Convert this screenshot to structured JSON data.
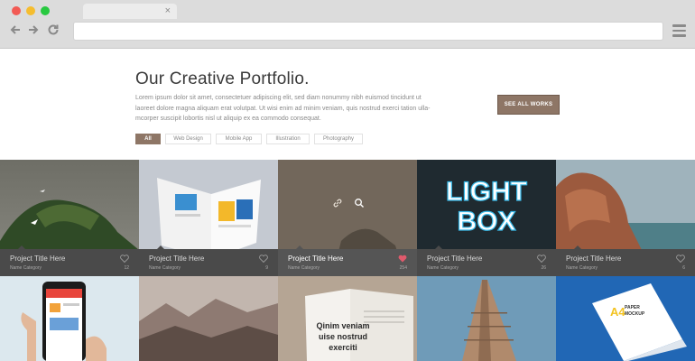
{
  "page": {
    "title": "Our Creative Portfolio.",
    "intro_lines": [
      "Lorem ipsum dolor sit amet, consectetuer adipiscing elit, sed diam nonummy nibh euismod tincidunt ut",
      "laoreet dolore magna aliquam erat volutpat. Ut wisi enim ad minim veniam, quis nostrud exerci tation ulla-",
      "mcorper suscipit lobortis nisl ut aliquip ex ea commodo consequat."
    ],
    "see_all_label": "SEE ALL WORKS",
    "filters": [
      "All",
      "Web Design",
      "Mobile App",
      "Illustration",
      "Photography"
    ],
    "active_filter": "All"
  },
  "projects": [
    {
      "title": "Project Title Here",
      "category": "Name Category",
      "likes": "12",
      "liked": false
    },
    {
      "title": "Project Title Here",
      "category": "Name Category",
      "likes": "9",
      "liked": false
    },
    {
      "title": "Project Title Here",
      "category": "Name Category",
      "likes": "254",
      "liked": true
    },
    {
      "title": "Project Title Here",
      "category": "Name Category",
      "likes": "26",
      "liked": false
    },
    {
      "title": "Project Title Here",
      "category": "Name Category",
      "likes": "6",
      "liked": false
    }
  ],
  "image_text": {
    "lightbox_line1": "LIGHT",
    "lightbox_line2": "BOX",
    "book_text": [
      "Qinim veniam",
      "uise nostrud",
      "exerciti"
    ],
    "paper_mockup": [
      "A4",
      "PAPER",
      "MOCKUP"
    ]
  },
  "colors": {
    "accent": "#8e7666",
    "caption_bg": "#4a4a4a",
    "heart_active": "#e05a6c"
  },
  "icons": {
    "link": "link-icon",
    "search": "search-icon",
    "heart": "heart-icon"
  }
}
